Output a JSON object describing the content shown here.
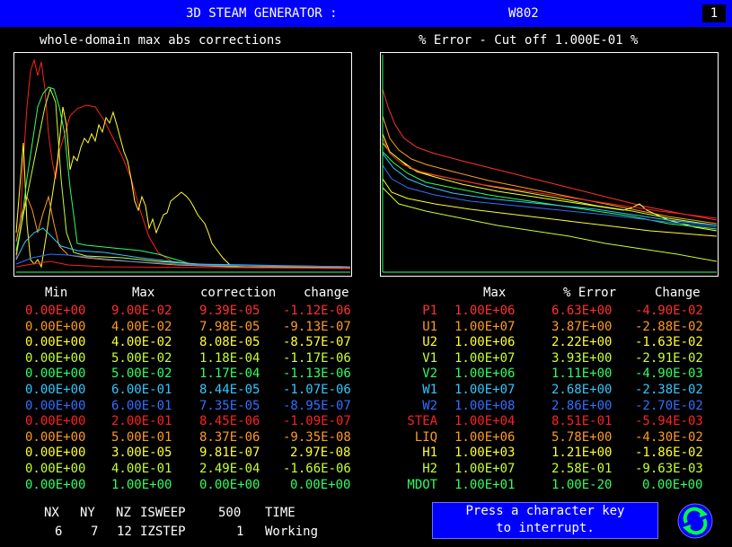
{
  "title": {
    "left": "3D STEAM GENERATOR :",
    "right": "W802",
    "page": "1"
  },
  "plots": {
    "left_title": "whole-domain max abs corrections",
    "right_title": "% Error - Cut off 1.000E-01 %"
  },
  "left_table": {
    "headers": {
      "min": "Min",
      "max": "Max",
      "correction": "correction",
      "change": "change"
    },
    "rows": [
      {
        "min": "0.00E+00",
        "max": "9.00E-02",
        "correction": "9.39E-05",
        "change": "-1.12E-06",
        "color": "#ff3030"
      },
      {
        "min": "0.00E+00",
        "max": "4.00E-02",
        "correction": "7.98E-05",
        "change": "-9.13E-07",
        "color": "#ff9a20"
      },
      {
        "min": "0.00E+00",
        "max": "4.00E-02",
        "correction": "8.08E-05",
        "change": "-8.57E-07",
        "color": "#ffff30"
      },
      {
        "min": "0.00E+00",
        "max": "5.00E-02",
        "correction": "1.18E-04",
        "change": "-1.17E-06",
        "color": "#c8ff30"
      },
      {
        "min": "0.00E+00",
        "max": "5.00E-02",
        "correction": "1.17E-04",
        "change": "-1.13E-06",
        "color": "#30ff60"
      },
      {
        "min": "0.00E+00",
        "max": "6.00E-01",
        "correction": "8.44E-05",
        "change": "-1.07E-06",
        "color": "#30c8ff"
      },
      {
        "min": "0.00E+00",
        "max": "6.00E-01",
        "correction": "7.35E-05",
        "change": "-8.95E-07",
        "color": "#3070ff"
      },
      {
        "min": "0.00E+00",
        "max": "2.00E-01",
        "correction": "8.45E-06",
        "change": "-1.09E-07",
        "color": "#ff2020"
      },
      {
        "min": "0.00E+00",
        "max": "5.00E-01",
        "correction": "8.37E-06",
        "change": "-9.35E-08",
        "color": "#ff9a20"
      },
      {
        "min": "0.00E+00",
        "max": "3.00E-05",
        "correction": "9.81E-07",
        "change": "2.97E-08",
        "color": "#ffff30"
      },
      {
        "min": "0.00E+00",
        "max": "4.00E-01",
        "correction": "2.49E-04",
        "change": "-1.66E-06",
        "color": "#c8ff30"
      },
      {
        "min": "0.00E+00",
        "max": "1.00E+00",
        "correction": "0.00E+00",
        "change": "0.00E+00",
        "color": "#30ff60"
      }
    ]
  },
  "right_table": {
    "headers": {
      "max": "Max",
      "error": "% Error",
      "change": "Change"
    },
    "rows": [
      {
        "name": "P1",
        "max": "1.00E+06",
        "error": "6.63E+00",
        "change": "-4.90E-02",
        "color": "#ff3030"
      },
      {
        "name": "U1",
        "max": "1.00E+07",
        "error": "3.87E+00",
        "change": "-2.88E-02",
        "color": "#ff9a20"
      },
      {
        "name": "U2",
        "max": "1.00E+06",
        "error": "2.22E+00",
        "change": "-1.63E-02",
        "color": "#ffff30"
      },
      {
        "name": "V1",
        "max": "1.00E+07",
        "error": "3.93E+00",
        "change": "-2.91E-02",
        "color": "#c8ff30"
      },
      {
        "name": "V2",
        "max": "1.00E+06",
        "error": "1.11E+00",
        "change": "-4.90E-03",
        "color": "#30ff60"
      },
      {
        "name": "W1",
        "max": "1.00E+07",
        "error": "2.68E+00",
        "change": "-2.38E-02",
        "color": "#30c8ff"
      },
      {
        "name": "W2",
        "max": "1.00E+08",
        "error": "2.86E+00",
        "change": "-2.70E-02",
        "color": "#3070ff"
      },
      {
        "name": "STEA",
        "max": "1.00E+04",
        "error": "8.51E-01",
        "change": "-5.94E-03",
        "color": "#ff2020"
      },
      {
        "name": "LIQ",
        "max": "1.00E+06",
        "error": "5.78E+00",
        "change": "-4.30E-02",
        "color": "#ff9a20"
      },
      {
        "name": "H1",
        "max": "1.00E+03",
        "error": "1.21E+00",
        "change": "-1.86E-02",
        "color": "#ffff30"
      },
      {
        "name": "H2",
        "max": "1.00E+07",
        "error": "2.58E-01",
        "change": "-9.63E-03",
        "color": "#c8ff30"
      },
      {
        "name": "MDOT",
        "max": "1.00E+01",
        "error": "1.00E-20",
        "change": "0.00E+00",
        "color": "#30ff60"
      }
    ]
  },
  "bottom": {
    "row1": {
      "nx": "NX",
      "ny": "NY",
      "nz": "NZ",
      "isweep": "ISWEEP",
      "isweep_val": "500",
      "time": "TIME"
    },
    "row2": {
      "nx": "6",
      "ny": "7",
      "nz": "12",
      "izstep": "IZSTEP",
      "izstep_val": "1",
      "status": "Working"
    }
  },
  "interrupt_message": {
    "line1": "Press a character key",
    "line2": "to interrupt."
  },
  "icons": {
    "refresh": "refresh-icon"
  }
}
